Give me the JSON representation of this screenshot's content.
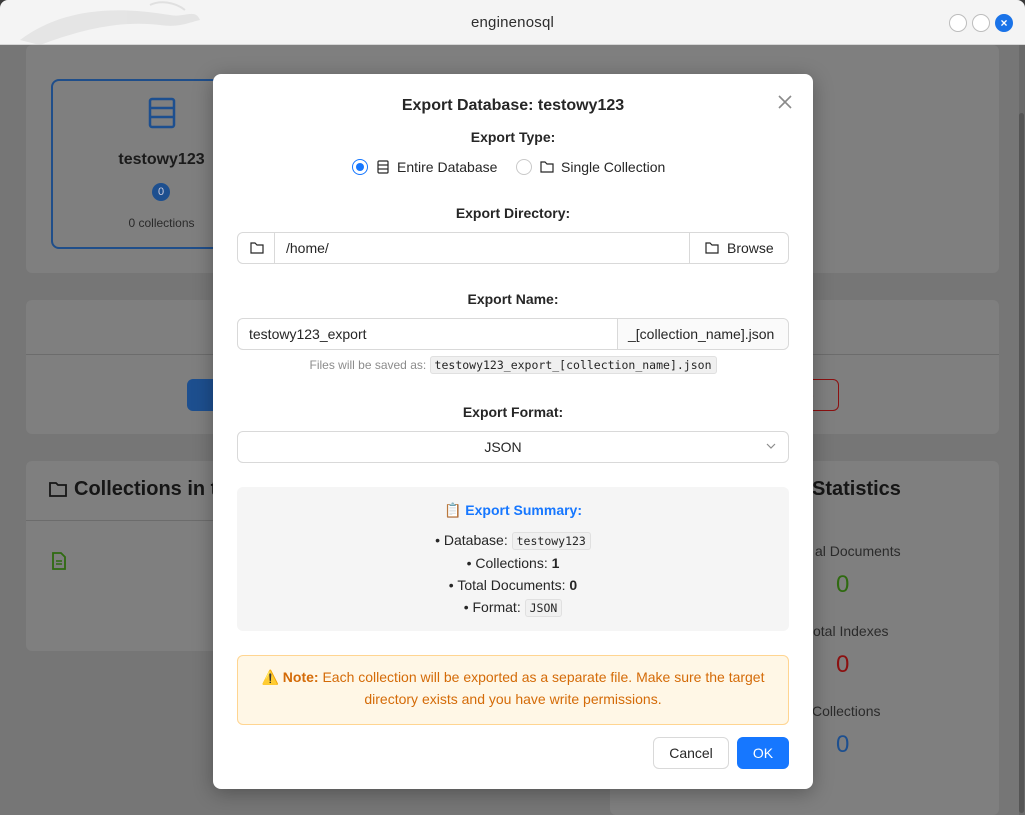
{
  "window": {
    "title": "enginenosql"
  },
  "background": {
    "db_card": {
      "name": "testowy123",
      "badge": "0",
      "subtitle": "0 collections"
    },
    "collections_heading": "Collections in t",
    "stats_heading": "Statistics",
    "partial_button": "e",
    "stats": [
      {
        "label": "al Documents",
        "value": "0",
        "color": "#2f6a10"
      },
      {
        "label": "otal Indexes",
        "value": "0",
        "color": "#8b1010"
      },
      {
        "label": "Collections",
        "value": "0",
        "color": "#1d4f8f"
      }
    ]
  },
  "modal": {
    "title": "Export Database: testowy123",
    "export_type_label": "Export Type:",
    "options": [
      {
        "label": "Entire Database",
        "checked": true,
        "icon": "database-icon"
      },
      {
        "label": "Single Collection",
        "checked": false,
        "icon": "folder-icon"
      }
    ],
    "directory_label": "Export Directory:",
    "directory_value": "/home/",
    "browse_label": "Browse",
    "name_label": "Export Name:",
    "name_value": "testowy123_export",
    "name_suffix": "_[collection_name].json",
    "hint_prefix": "Files will be saved as:",
    "hint_file": "testowy123_export_[collection_name].json",
    "format_label": "Export Format:",
    "format_value": "JSON",
    "summary": {
      "heading": "📋 Export Summary:",
      "database_label": "• Database:",
      "database_value": "testowy123",
      "collections_label": "• Collections:",
      "collections_value": "1",
      "documents_label": "• Total Documents:",
      "documents_value": "0",
      "format_label": "• Format:",
      "format_value": "JSON"
    },
    "note": {
      "prefix": "⚠️ Note:",
      "text": "Each collection will be exported as a separate file. Make sure the target directory exists and you have write permissions."
    },
    "cancel_label": "Cancel",
    "ok_label": "OK"
  }
}
